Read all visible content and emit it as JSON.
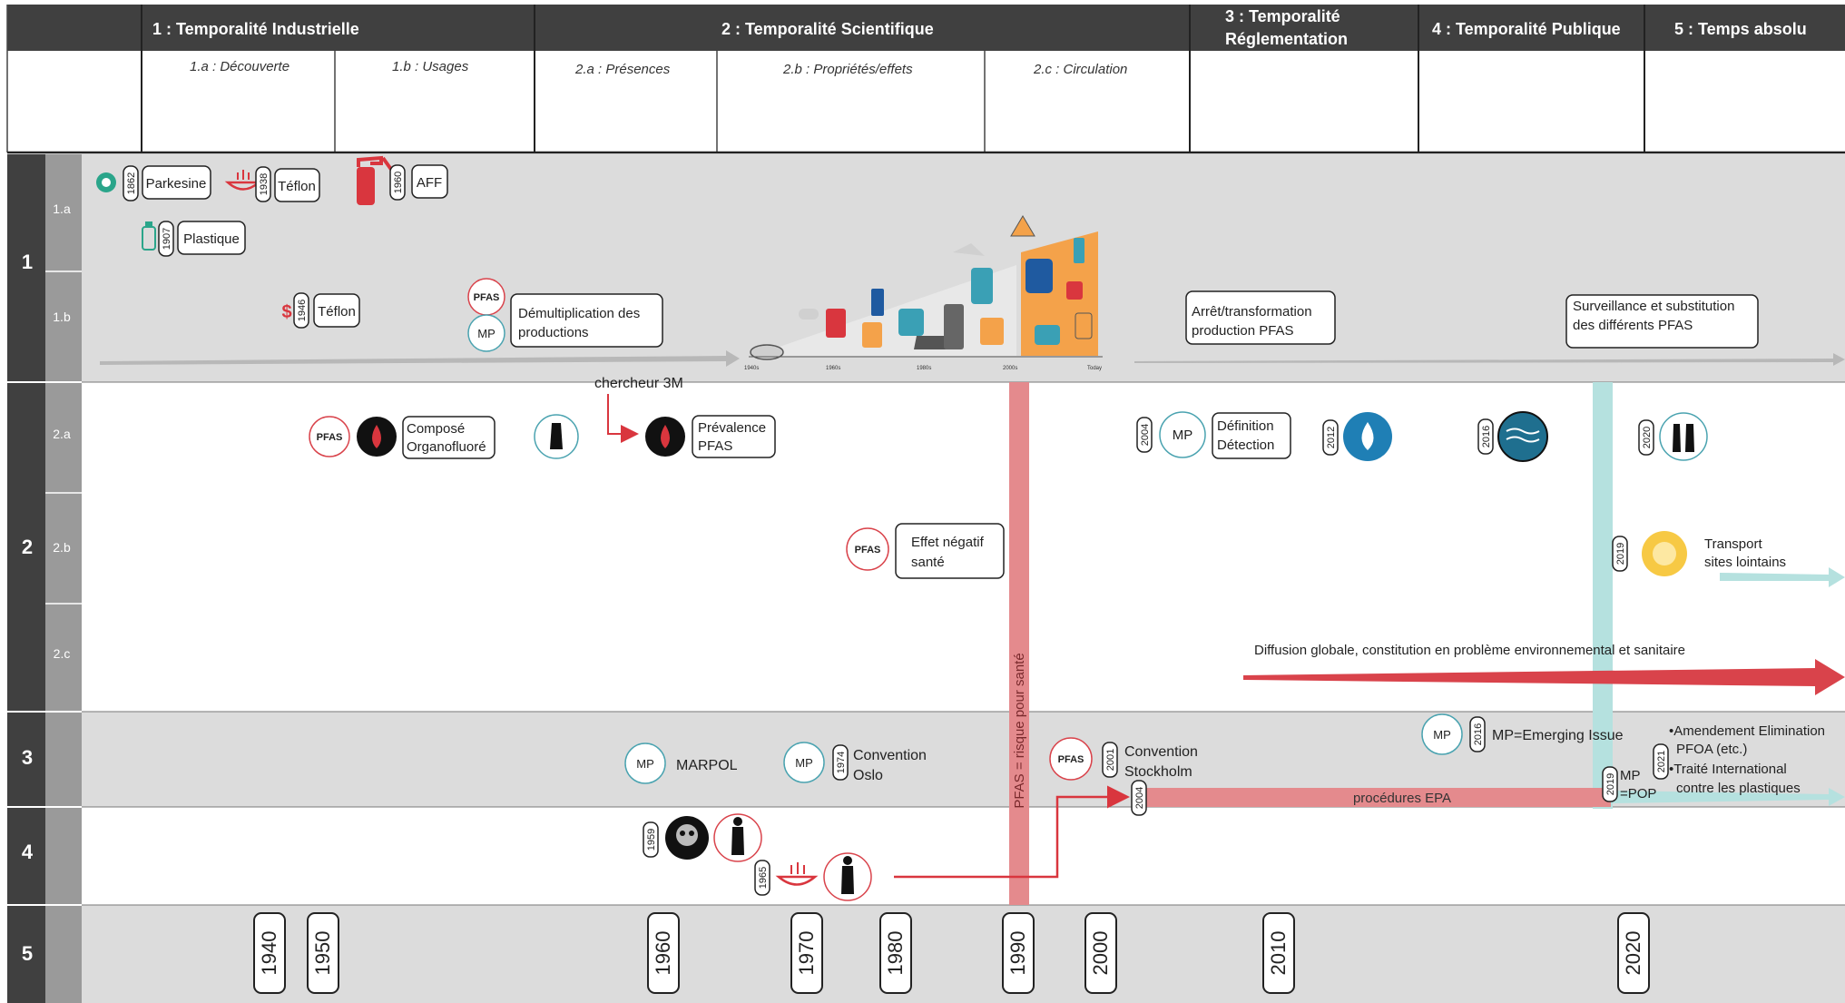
{
  "header": {
    "columns": [
      {
        "id": "c1",
        "label": "1 : Temporalité Industrielle"
      },
      {
        "id": "c2",
        "label": "2 : Temporalité Scientifique"
      },
      {
        "id": "c3",
        "label_line1": "3 : Temporalité",
        "label_line2": "Réglementation"
      },
      {
        "id": "c4",
        "label": "4 : Temporalité Publique"
      },
      {
        "id": "c5",
        "label": "5 : Temps absolu"
      }
    ],
    "subcolumns": [
      "1.a : Découverte",
      "1.b : Usages",
      "2.a : Présences",
      "2.b : Propriétés/effets",
      "2.c : Circulation"
    ]
  },
  "rows": {
    "main": [
      "1",
      "2",
      "3",
      "4",
      "5"
    ],
    "sub": [
      "1.a",
      "1.b",
      "2.a",
      "2.b",
      "2.c"
    ]
  },
  "row1a": {
    "parkesine_year": "1862",
    "parkesine": "Parkesine",
    "teflon_year": "1938",
    "teflon": "Téflon",
    "aff_year": "1960",
    "aff": "AFF",
    "plastique_year": "1907",
    "plastique": "Plastique"
  },
  "row1b": {
    "teflon_year": "1946",
    "teflon": "Téflon",
    "dollar": "$",
    "pfas_badge": "PFAS",
    "mp_badge": "MP",
    "demult_line1": "Démultiplication des",
    "demult_line2": "productions",
    "arret_line1": "Arrêt/transformation",
    "arret_line2": "production PFAS",
    "surv_line1": "Surveillance et substitution",
    "surv_line2": "des différents PFAS",
    "illus_ticks": [
      "1940s",
      "1960s",
      "1980s",
      "2000s",
      "Today"
    ]
  },
  "row2a": {
    "chercheur": "chercheur 3M",
    "pfas_badge": "PFAS",
    "compose_line1": "Composé",
    "compose_line2": "Organofluoré",
    "prevalence_line1": "Prévalence",
    "prevalence_line2": "PFAS",
    "y2004": "2004",
    "mp_badge": "MP",
    "definition_line1": "Définition",
    "definition_line2": "Détection",
    "y2012": "2012",
    "y2016": "2016",
    "y2020": "2020"
  },
  "row2b": {
    "pfas_badge": "PFAS",
    "effet_line1": "Effet négatif",
    "effet_line2": "santé",
    "y2019": "2019",
    "transport_line1": "Transport",
    "transport_line2": "sites lointains"
  },
  "row2c": {
    "diffusion": "Diffusion globale, constitution en problème environnemental et sanitaire"
  },
  "vertical_label": "PFAS = risque pour santé",
  "row3": {
    "mp_badge": "MP",
    "marpol": "MARPOL",
    "y1974": "1974",
    "oslo_line1": "Convention",
    "oslo_line2": "Oslo",
    "pfas_badge": "PFAS",
    "y2001": "2001",
    "stockholm_line1": "Convention",
    "stockholm_line2": "Stockholm",
    "y2016": "2016",
    "emerging": "MP=Emerging Issue",
    "y2004": "2004",
    "epa": "procédures EPA",
    "y2019": "2019",
    "mppop_line1": "MP",
    "mppop_line2": "=POP",
    "y2021": "2021",
    "amend_line1": "•Amendement Elimination",
    "amend_line2": "PFOA (etc.)",
    "amend_line3": "•Traité International",
    "amend_line4": "contre les plastiques"
  },
  "row4": {
    "y1959": "1959",
    "y1965": "1965"
  },
  "timeline": [
    "1940",
    "1950",
    "1960",
    "1970",
    "1980",
    "1990",
    "2000",
    "2010",
    "2020"
  ],
  "colors": {
    "header_bg": "#404040",
    "label_col_dark": "#404040",
    "label_col_light": "#9a9a9a",
    "band_grey": "#dcdcdc",
    "red_accent": "#d9434b",
    "pink_bar": "#e48a8d",
    "teal_bar": "#b5e1df",
    "teal_accent": "#4aa3b0",
    "orange_bg": "#f4a24a"
  }
}
